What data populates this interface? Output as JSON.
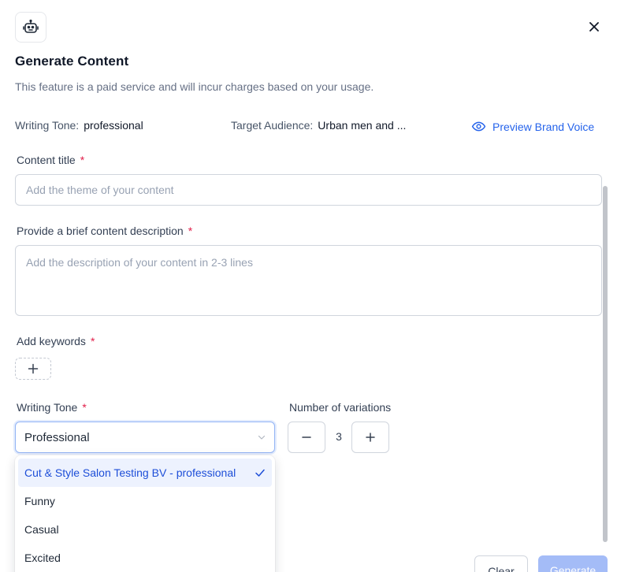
{
  "header": {
    "icon": "robot-icon",
    "title": "Generate Content",
    "subtitle": "This feature is a paid service and will incur charges based on your usage.",
    "close_icon": "close-icon"
  },
  "meta": {
    "writing_tone_label": "Writing Tone:",
    "writing_tone_value": "professional",
    "audience_label": "Target Audience:",
    "audience_value": "Urban men and ...",
    "preview_label": "Preview Brand Voice",
    "preview_icon": "eye-icon"
  },
  "form": {
    "title_label": "Content title",
    "title_placeholder": "Add the theme of your content",
    "description_label": "Provide a brief content description",
    "description_placeholder": "Add the description of your content in 2-3 lines",
    "keywords_label": "Add keywords",
    "tone_label": "Writing Tone",
    "tone_selected": "Professional",
    "variations_label": "Number of variations",
    "variations_value": "3",
    "required_marker": "*"
  },
  "dropdown": {
    "options": [
      {
        "label": "Cut & Style Salon Testing BV - professional",
        "selected": true
      },
      {
        "label": "Funny",
        "selected": false
      },
      {
        "label": "Casual",
        "selected": false
      },
      {
        "label": "Excited",
        "selected": false
      }
    ]
  },
  "footer": {
    "clear_label": "Clear",
    "generate_label": "Generate"
  },
  "colors": {
    "accent": "#2563eb",
    "required": "#e11d48",
    "generate_disabled": "#a4bcf7",
    "selected_option_bg": "#edf2fe"
  }
}
